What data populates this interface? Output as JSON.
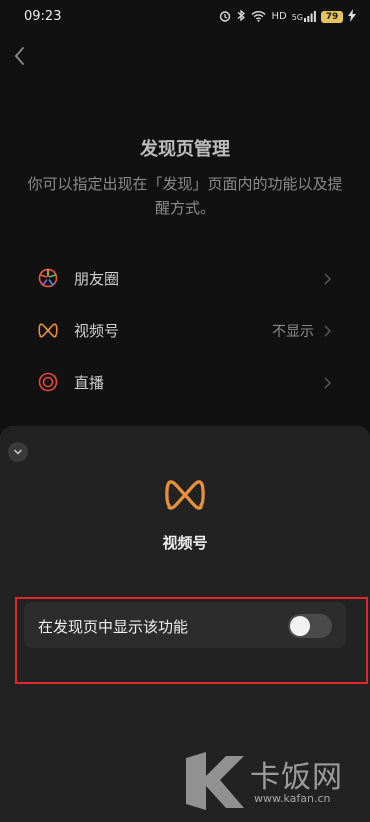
{
  "status_bar": {
    "time": "09:23",
    "icons": [
      "alarm-icon",
      "bluetooth-icon",
      "wifi-icon",
      "hd-icon",
      "signal-icon",
      "battery-icon",
      "charging-icon"
    ],
    "hd_label": "HD",
    "network_label": "5G",
    "battery_level": "79"
  },
  "header": {
    "title": "发现页管理",
    "description": "你可以指定出现在「发现」页面内的功能以及提醒方式。"
  },
  "list": {
    "items": [
      {
        "label": "朋友圈",
        "value": "",
        "icon": "moments-icon"
      },
      {
        "label": "视频号",
        "value": "不显示",
        "icon": "channels-icon"
      },
      {
        "label": "直播",
        "value": "",
        "icon": "live-icon"
      }
    ]
  },
  "sheet": {
    "title": "视频号",
    "toggle_label": "在发现页中显示该功能",
    "toggle_on": false
  },
  "watermark": {
    "brand": "卡饭网",
    "url": "www.kafan.cn"
  },
  "colors": {
    "channels_orange": "#e8903a",
    "highlight_red": "#e0272c"
  }
}
